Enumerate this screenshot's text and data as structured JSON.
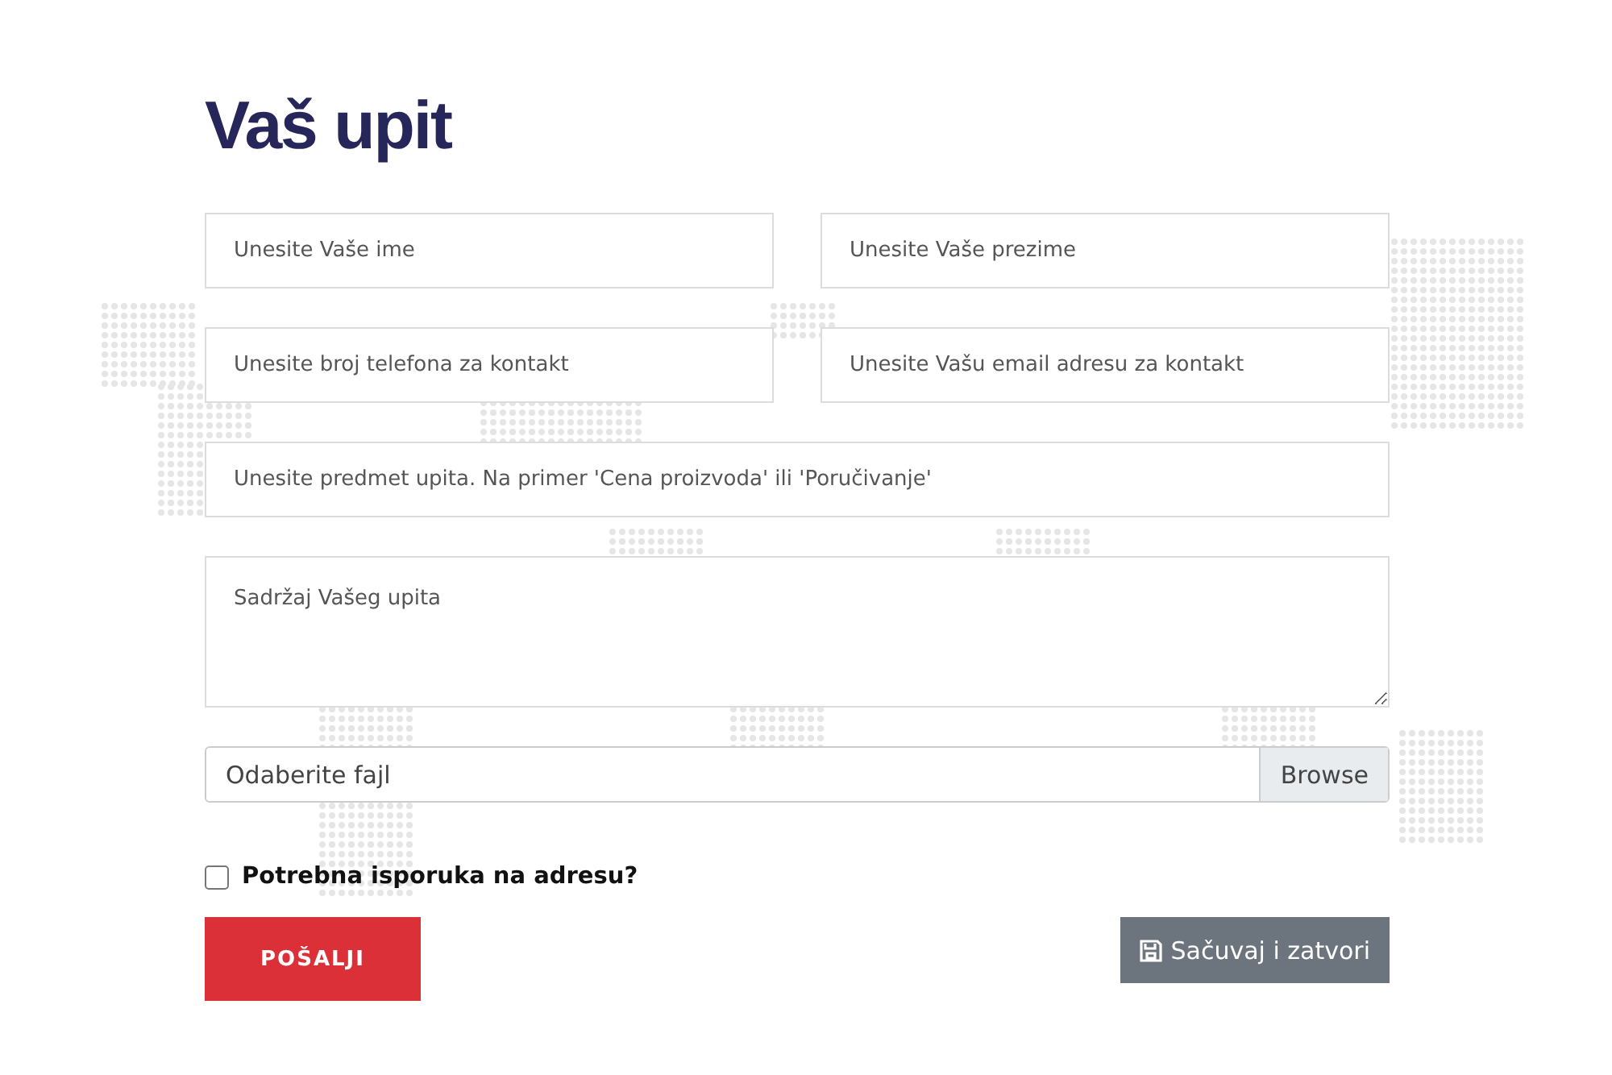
{
  "title": "Vaš upit",
  "field_rows": [
    [
      {
        "kind": "text",
        "placeholder": "Unesite Vaše ime"
      },
      {
        "kind": "text",
        "placeholder": "Unesite Vaše prezime"
      }
    ],
    [
      {
        "kind": "text",
        "placeholder": "Unesite broj telefona za kontakt"
      },
      {
        "kind": "text",
        "placeholder": "Unesite Vašu email adresu za kontakt"
      }
    ],
    [
      {
        "kind": "text",
        "placeholder": "Unesite predmet upita. Na primer 'Cena proizvoda' ili 'Poručivanje'"
      }
    ],
    [
      {
        "kind": "textarea",
        "placeholder": "Sadržaj Vašeg upita"
      }
    ]
  ],
  "file_input": {
    "placeholder": "Odaberite fajl",
    "button": "Browse"
  },
  "checkbox": {
    "label": "Potrebna isporuka na adresu?",
    "checked": false
  },
  "submit_button": "POŠALJI",
  "save_button": "Sačuvaj i zatvori"
}
